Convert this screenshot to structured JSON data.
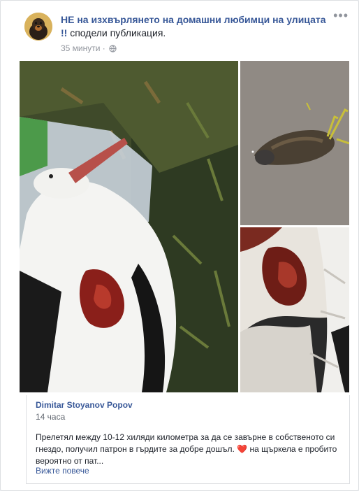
{
  "post": {
    "page_name": "НЕ на изхвърлянето на домашни любимци на улицата !!",
    "action": " сподели публикация.",
    "time": "35 минути",
    "separator": " · ",
    "more_icon": "more-horizontal-icon",
    "privacy_icon": "globe-icon"
  },
  "shared": {
    "author": "Dimitar Stoyanov Popov",
    "time": "14 часа",
    "text_before": "Прелетял между 10-12 хиляди километра за да се завърне в собственото си гнездо, получил патрон в гърдите за добре дошъл. ",
    "heart": "❤️",
    "text_after": " на щъркела е пробито вероятно от пат...",
    "see_more": "Вижте повече"
  },
  "photos": [
    {
      "id": "photo-1",
      "subject": "wounded stork on grass"
    },
    {
      "id": "photo-2",
      "subject": "dead bird on asphalt"
    },
    {
      "id": "photo-3",
      "subject": "close-up of wound"
    }
  ],
  "colors": {
    "link": "#385898",
    "meta": "#90949c",
    "heart": "#e0245e"
  }
}
